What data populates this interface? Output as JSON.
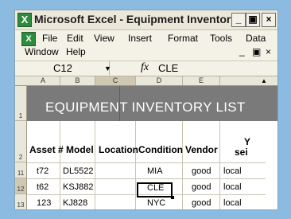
{
  "window": {
    "title": "Microsoft Excel - Equipment Inventory.xls",
    "controls": {
      "minimize": "_",
      "restore": "▣",
      "close": "×"
    }
  },
  "menu": {
    "row1": [
      "File",
      "Edit",
      "View",
      "Insert",
      "Format",
      "Tools",
      "Data"
    ],
    "row2": [
      "Window",
      "Help"
    ],
    "doc_controls": {
      "minimize": "_",
      "restore": "▣",
      "close": "×"
    }
  },
  "formula_bar": {
    "cell_ref": "C12",
    "fx": "fx",
    "value": "CLE"
  },
  "columns": [
    "A",
    "B",
    "C",
    "D",
    "E"
  ],
  "rows": [
    "1",
    "2",
    "11",
    "12",
    "13"
  ],
  "title": "EQUIPMENT INVENTORY LIST",
  "headers": [
    "Asset #",
    "Model",
    "Location",
    "Condition",
    "Vendor",
    "Y",
    "sei"
  ],
  "data_rows": [
    [
      "t72",
      "DL5522",
      "MIA",
      "good",
      "local"
    ],
    [
      "t62",
      "KSJ882",
      "CLE",
      "good",
      "local"
    ],
    [
      "123",
      "KJ828",
      "NYC",
      "good",
      "local"
    ]
  ],
  "colors": {
    "background": "#8bbbe0",
    "title_band": "#7a7a7a",
    "excel_green": "#2e8b3e"
  }
}
